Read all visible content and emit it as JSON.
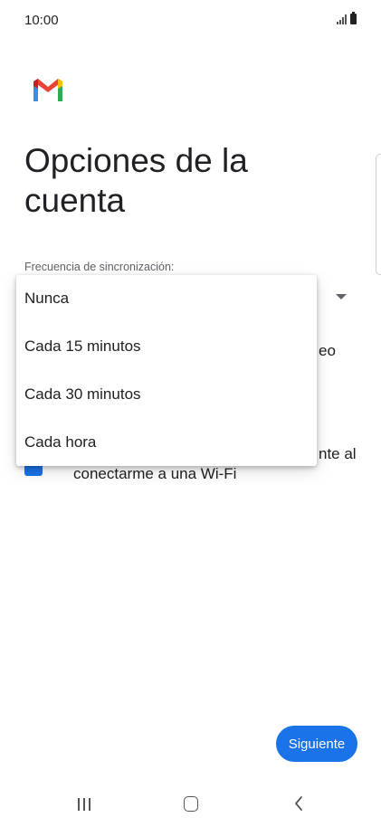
{
  "status_bar": {
    "time": "10:00",
    "signal_icon": "signal-icon",
    "battery_icon": "battery-icon"
  },
  "header": {
    "logo_icon": "gmail-logo-icon",
    "title": "Opciones de la cuenta"
  },
  "form": {
    "sync_label": "Frecuencia de sincronización:",
    "background_fragments": [
      "eo",
      "nte al",
      "conectarme a una Wi-Fi"
    ]
  },
  "dropdown_menu": {
    "options": [
      "Nunca",
      "Cada 15 minutos",
      "Cada 30 minutos",
      "Cada hora"
    ]
  },
  "footer": {
    "next_label": "Siguiente"
  },
  "navigation": {
    "recents_icon": "recents-icon",
    "home_icon": "home-icon",
    "back_icon": "back-icon"
  },
  "colors": {
    "accent": "#1a73e8",
    "text_primary": "#202124",
    "text_secondary": "#5f6368"
  }
}
